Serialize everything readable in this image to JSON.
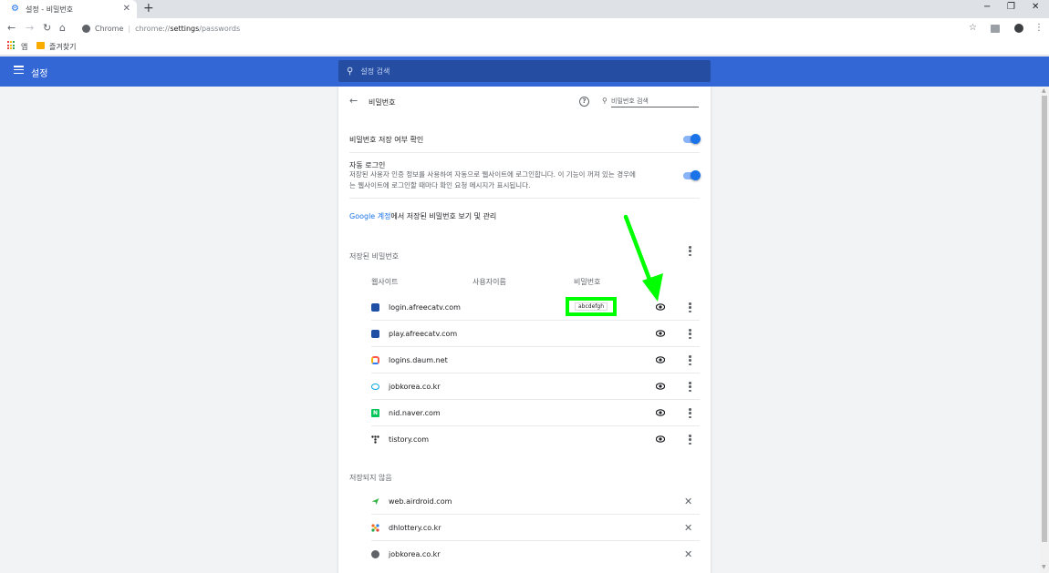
{
  "tab": {
    "title": "설정 - 비밀번호"
  },
  "window_controls": {
    "minimize": "−",
    "restore": "❐",
    "close": "✕"
  },
  "omnibox": {
    "chrome_label": "Chrome",
    "url_prefix": "chrome://",
    "url_host": "settings",
    "url_path": "/passwords"
  },
  "bookmarks": {
    "apps_label": "앱",
    "folder_label": "즐겨찾기"
  },
  "settings_header": {
    "title": "설정",
    "search_placeholder": "설정 검색"
  },
  "passwords": {
    "title": "비밀번호",
    "search_placeholder": "비밀번호 검색",
    "offer_save_label": "비밀번호 저장 여부 확인",
    "offer_save_enabled": true,
    "auto_signin_label": "자동 로그인",
    "auto_signin_desc_line1": "저장된 사용자 인증 정보를 사용하여 자동으로 웹사이트에 로그인합니다. 이 기능이 꺼져 있는 경우에",
    "auto_signin_desc_line2": "는 웹사이트에 로그인할 때마다 확인 요청 메시지가 표시됩니다.",
    "auto_signin_enabled": true,
    "google_link": "Google 계정",
    "google_link_suffix": "에서 저장된 비밀번호 보기 및 관리",
    "saved_section_title": "저장된 비밀번호",
    "columns": {
      "website": "웹사이트",
      "username": "사용자이름",
      "password": "비밀번호"
    },
    "saved": [
      {
        "site": "login.afreecatv.com",
        "icon": "afreecatv-icon",
        "password_shown": "abcdefgh"
      },
      {
        "site": "play.afreecatv.com",
        "icon": "afreecatv-icon"
      },
      {
        "site": "logins.daum.net",
        "icon": "daum-icon"
      },
      {
        "site": "jobkorea.co.kr",
        "icon": "jobkorea-icon"
      },
      {
        "site": "nid.naver.com",
        "icon": "naver-icon"
      },
      {
        "site": "tistory.com",
        "icon": "tistory-icon"
      }
    ],
    "never_section_title": "저장되지 않음",
    "never": [
      {
        "site": "web.airdroid.com",
        "icon": "airdroid-icon"
      },
      {
        "site": "dhlottery.co.kr",
        "icon": "dhlottery-icon"
      },
      {
        "site": "jobkorea.co.kr",
        "icon": "globe-icon"
      }
    ]
  },
  "colors": {
    "header_blue": "#3367d6",
    "toggle_blue": "#1a73e8",
    "annotation_green": "#00ff00"
  }
}
